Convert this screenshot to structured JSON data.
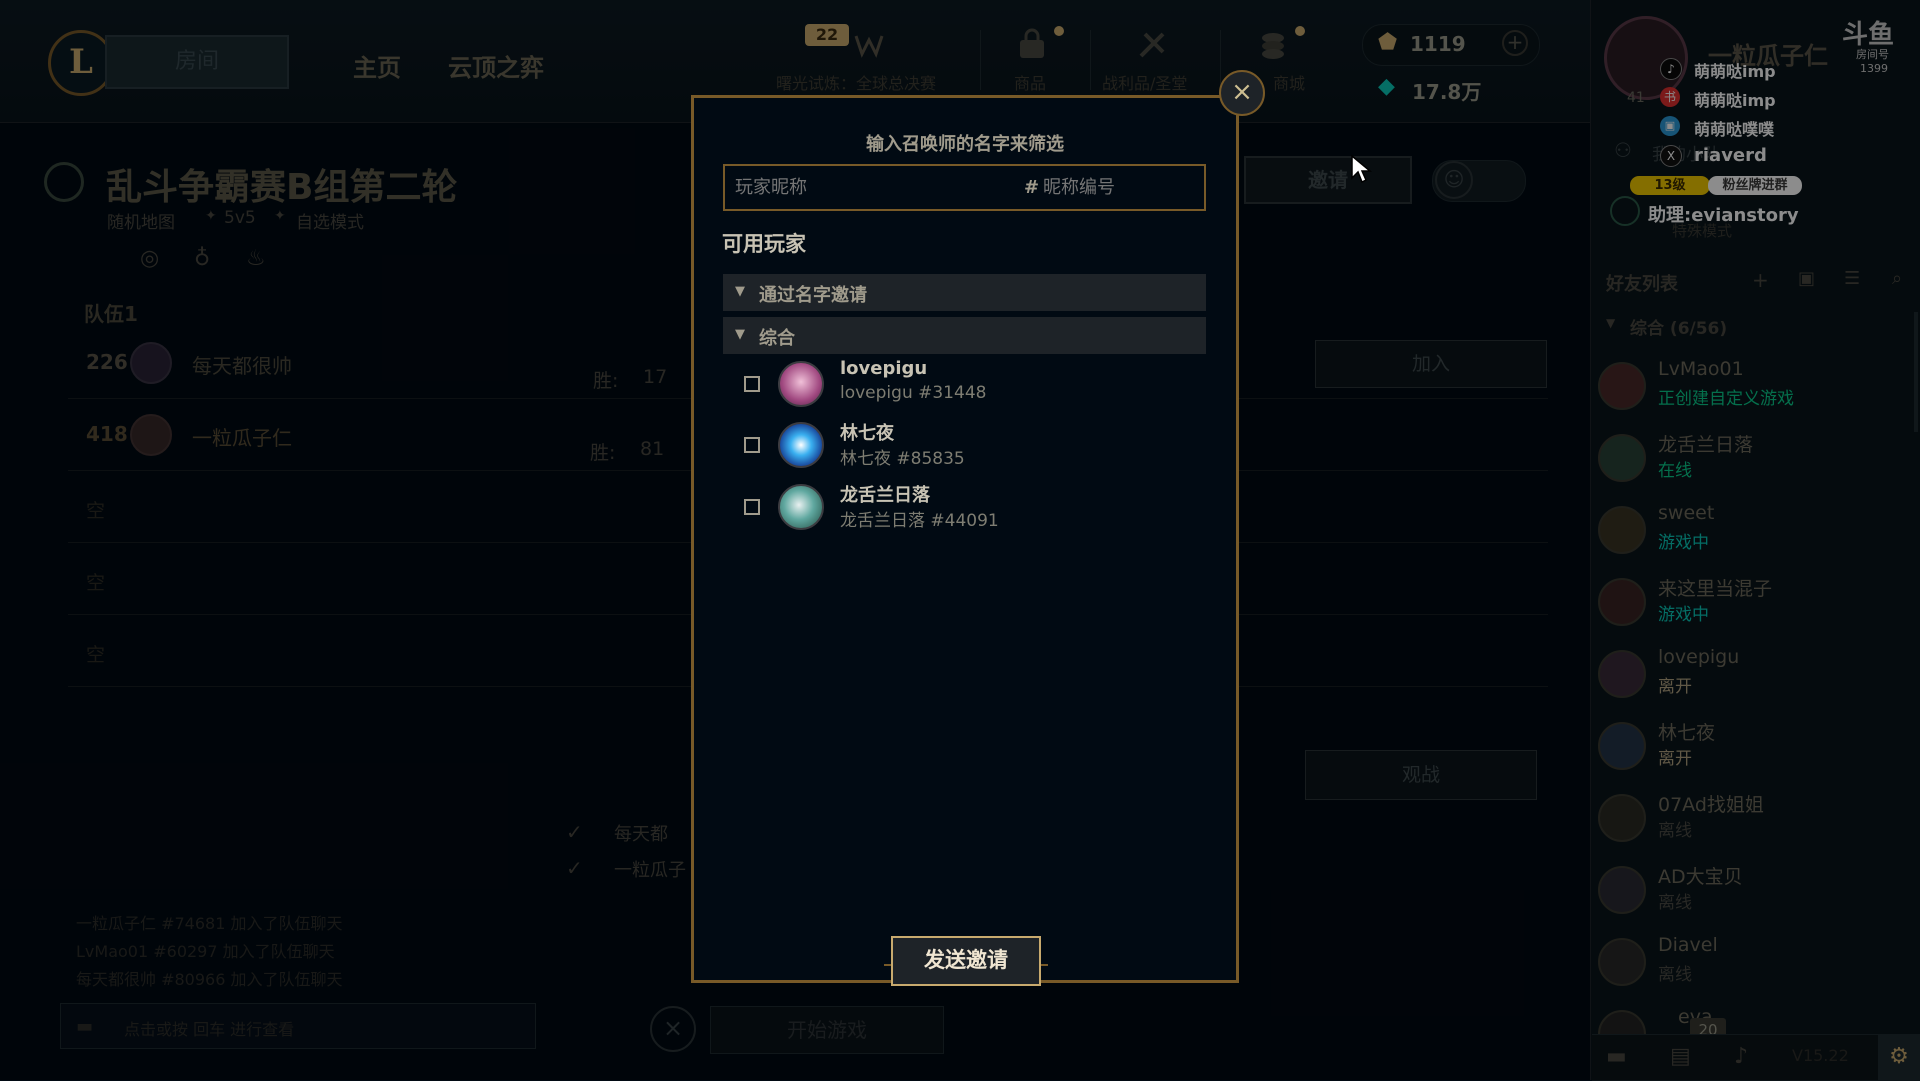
{
  "nav": {
    "logo": "L",
    "play_label": "房间",
    "tabs": [
      "主页",
      "云顶之弈"
    ],
    "level_badge": "22",
    "event_label": "曙光试炼：全球总决赛",
    "store_items": [
      "商品",
      "战利品/圣堂",
      "商城"
    ],
    "rp": "1119",
    "be": "17.8万"
  },
  "lobby": {
    "title": "乱斗争霸赛B组第二轮",
    "meta": [
      "随机地图",
      "5v5",
      "自选模式"
    ],
    "team_label": "队伍1",
    "players": [
      {
        "level": "226",
        "name": "每天都很帅",
        "wins_label": "胜:",
        "wins": "17"
      },
      {
        "level": "418",
        "name": "一粒瓜子仁",
        "wins_label": "胜:",
        "wins": "81"
      }
    ],
    "empty_label": "空",
    "join_label": "加入",
    "invite_label": "邀请",
    "spectate_label": "观战",
    "ready_list": [
      "每天都",
      "一粒瓜子"
    ],
    "chat_log": [
      "一粒瓜子仁 #74681 加入了队伍聊天",
      "LvMao01 #60297 加入了队伍聊天",
      "每天都很帅 #80966 加入了队伍聊天"
    ],
    "chat_placeholder": "点击或按 回车 进行查看",
    "start_label": "开始游戏"
  },
  "stream_overlay": {
    "socials": [
      {
        "icon": "douyin-icon",
        "text": "萌萌哒imp"
      },
      {
        "icon": "xiaohongshu-icon",
        "text": "萌萌哒imp"
      },
      {
        "icon": "bilibili-icon",
        "text": "萌萌哒噗噗"
      },
      {
        "icon": "x-icon",
        "text": "riaverd"
      }
    ],
    "level_tag": "13级",
    "group_tag": "粉丝牌进群",
    "assistant": "助理:evianstory",
    "site_logo": "斗鱼",
    "room_label": "房间号",
    "room_no": "1399"
  },
  "social": {
    "profile_name": "一粒瓜子仁",
    "profile_level": "41",
    "party_label": "我的小队",
    "party_mode": "特殊模式",
    "list_title": "好友列表",
    "group_label": "综合 (6/56)",
    "friends": [
      {
        "name": "LvMao01",
        "status": "正创建自定义游戏",
        "color": "#0acb8a"
      },
      {
        "name": "龙舌兰日落",
        "status": "在线",
        "color": "#0acb8a"
      },
      {
        "name": "sweet",
        "status": "游戏中",
        "color": "#0ac8b9"
      },
      {
        "name": "来这里当混子",
        "status": "游戏中",
        "color": "#0ac8b9"
      },
      {
        "name": "lovepigu",
        "status": "离开",
        "color": "#b0a080"
      },
      {
        "name": "林七夜",
        "status": "离开",
        "color": "#b0a080"
      },
      {
        "name": "07Ad找姐姐",
        "status": "离线",
        "color": "#4a4a44"
      },
      {
        "name": "AD大宝贝",
        "status": "离线",
        "color": "#4a4a44"
      },
      {
        "name": "Diavel",
        "status": "离线",
        "color": "#4a4a44"
      }
    ],
    "partial_name": "eva",
    "badge_count": "20",
    "version": "V15.22"
  },
  "modal": {
    "header": "输入召唤师的名字来筛选",
    "name_placeholder": "玩家昵称",
    "tag_placeholder": "昵称编号",
    "tag_prefix": "#",
    "section_title": "可用玩家",
    "groups": [
      "通过名字邀请",
      "综合"
    ],
    "players": [
      {
        "name": "lovepigu",
        "tag": "lovepigu #31448",
        "checked": false
      },
      {
        "name": "林七夜",
        "tag": "林七夜 #85835",
        "checked": false
      },
      {
        "name": "龙舌兰日落",
        "tag": "龙舌兰日落 #44091",
        "checked": false
      }
    ],
    "send_label": "发送邀请",
    "close_symbol": "×"
  },
  "colors": {
    "gold": "#c8aa6e",
    "gold_dark": "#785a28",
    "online": "#0acb8a",
    "in_game": "#0ac8b9"
  }
}
